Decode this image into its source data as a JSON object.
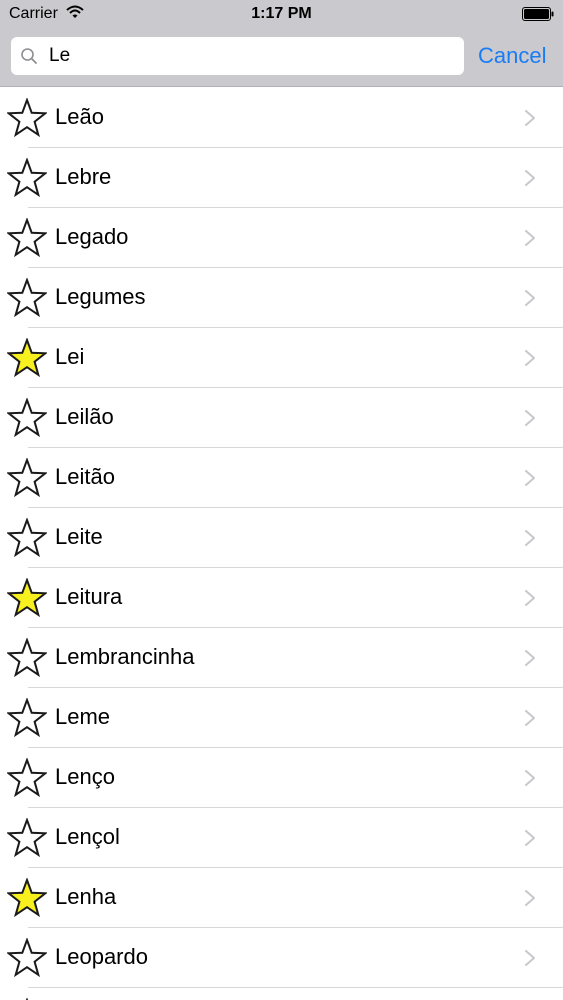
{
  "status_bar": {
    "carrier": "Carrier",
    "time": "1:17 PM"
  },
  "search": {
    "value": "Le",
    "placeholder": "",
    "cancel_label": "Cancel"
  },
  "colors": {
    "header_bg": "#c9c9ce",
    "accent": "#1a7cf5",
    "star_favorite": "#f7f01e",
    "star_empty": "#ffffff"
  },
  "list": {
    "items": [
      {
        "label": "Leão",
        "favorite": false
      },
      {
        "label": "Lebre",
        "favorite": false
      },
      {
        "label": "Legado",
        "favorite": false
      },
      {
        "label": "Legumes",
        "favorite": false
      },
      {
        "label": "Lei",
        "favorite": true
      },
      {
        "label": "Leilão",
        "favorite": false
      },
      {
        "label": "Leitão",
        "favorite": false
      },
      {
        "label": "Leite",
        "favorite": false
      },
      {
        "label": "Leitura",
        "favorite": true
      },
      {
        "label": "Lembrancinha",
        "favorite": false
      },
      {
        "label": "Leme",
        "favorite": false
      },
      {
        "label": "Lenço",
        "favorite": false
      },
      {
        "label": "Lençol",
        "favorite": false
      },
      {
        "label": "Lenha",
        "favorite": true
      },
      {
        "label": "Leopardo",
        "favorite": false
      },
      {
        "label": "",
        "favorite": false
      }
    ]
  }
}
